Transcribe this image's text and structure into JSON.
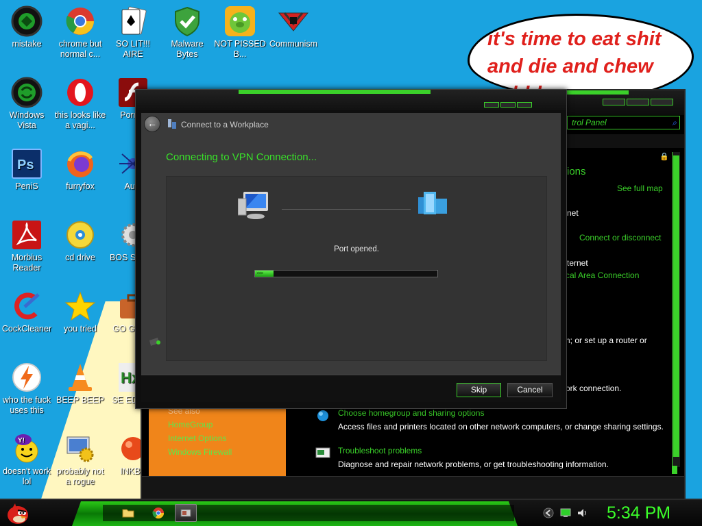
{
  "speech_bubble": {
    "text": "it's time to eat shit and die and chew bubble gum"
  },
  "desktop_icons": [
    {
      "label": "mistake",
      "icon": "green-orb-icon"
    },
    {
      "label": "chrome but normal c...",
      "icon": "chrome-icon"
    },
    {
      "label": "SO LIT!!! AIRE",
      "icon": "playing-card-icon"
    },
    {
      "label": "Malware Bytes",
      "icon": "shield-check-icon"
    },
    {
      "label": "NOT PISSED B...",
      "icon": "green-pig-icon"
    },
    {
      "label": "Communism",
      "icon": "emblem-icon"
    },
    {
      "label": "Windows Vista",
      "icon": "recycle-orb-icon"
    },
    {
      "label": "this looks like a vagi...",
      "icon": "opera-icon"
    },
    {
      "label": "Porn F",
      "icon": "flash-icon"
    },
    {
      "label": "PeniS",
      "icon": "photoshop-icon"
    },
    {
      "label": "furryfox",
      "icon": "firefox-icon"
    },
    {
      "label": "Aust",
      "icon": "spider-icon"
    },
    {
      "label": "Morbius Reader",
      "icon": "pdf-reader-icon"
    },
    {
      "label": "cd drive",
      "icon": "cd-drive-icon"
    },
    {
      "label": "BOS SIMUL",
      "icon": "gear-spiky-icon"
    },
    {
      "label": "CockCleaner",
      "icon": "ccleaner-icon"
    },
    {
      "label": "you tried",
      "icon": "star-icon"
    },
    {
      "label": "GO GADG",
      "icon": "briefcase-icon"
    },
    {
      "label": "who the fuck uses this",
      "icon": "lightning-icon"
    },
    {
      "label": "BEEP BEEP",
      "icon": "vlc-cone-icon"
    },
    {
      "label": "SE EDITIO",
      "icon": "hx-editor-icon"
    },
    {
      "label": "doesn't work lol",
      "icon": "yahoo-messenger-icon"
    },
    {
      "label": "probably not a rogue",
      "icon": "computer-gears-icon"
    },
    {
      "label": "INKBA",
      "icon": "ink-ball-icon"
    }
  ],
  "control_panel": {
    "search_placeholder": "trol Panel",
    "heading_fragment": "ions",
    "see_full_map": "See full map",
    "net_fragment": "net",
    "connect_or_disconnect": "Connect or disconnect",
    "internet_fragment": "ternet",
    "local_area_connection": "cal Area Connection",
    "router_text": "n; or set up a router or",
    "work_connection_text": "ork connection.",
    "choose_homegroup": "Choose homegroup and sharing options",
    "choose_homegroup_desc": "Access files and printers located on other network computers, or change sharing settings.",
    "troubleshoot": "Troubleshoot problems",
    "troubleshoot_desc": "Diagnose and repair network problems, or get troubleshooting information.",
    "see_also": {
      "heading": "See also",
      "items": [
        "HomeGroup",
        "Internet Options",
        "Windows Firewall"
      ]
    }
  },
  "wizard": {
    "title": "Connect to a Workplace",
    "heading": "Connecting to VPN Connection...",
    "status": "Port opened.",
    "progress_chevrons": ">>>",
    "progress_fraction": 0.1,
    "skip_label": "Skip",
    "cancel_label": "Cancel"
  },
  "taskbar": {
    "start_icon": "angry-bird-icon",
    "apps": [
      "folder-icon",
      "chrome-icon",
      "network-wizard-icon"
    ],
    "tray": [
      "back-arrow-icon",
      "network-monitor-icon",
      "volume-icon"
    ],
    "clock": "5:34 PM"
  },
  "colors": {
    "desktop": "#1aa3e0",
    "accent_green": "#3bd12a",
    "bubble_text": "#e0201c",
    "orange_panel": "#f0851a"
  }
}
